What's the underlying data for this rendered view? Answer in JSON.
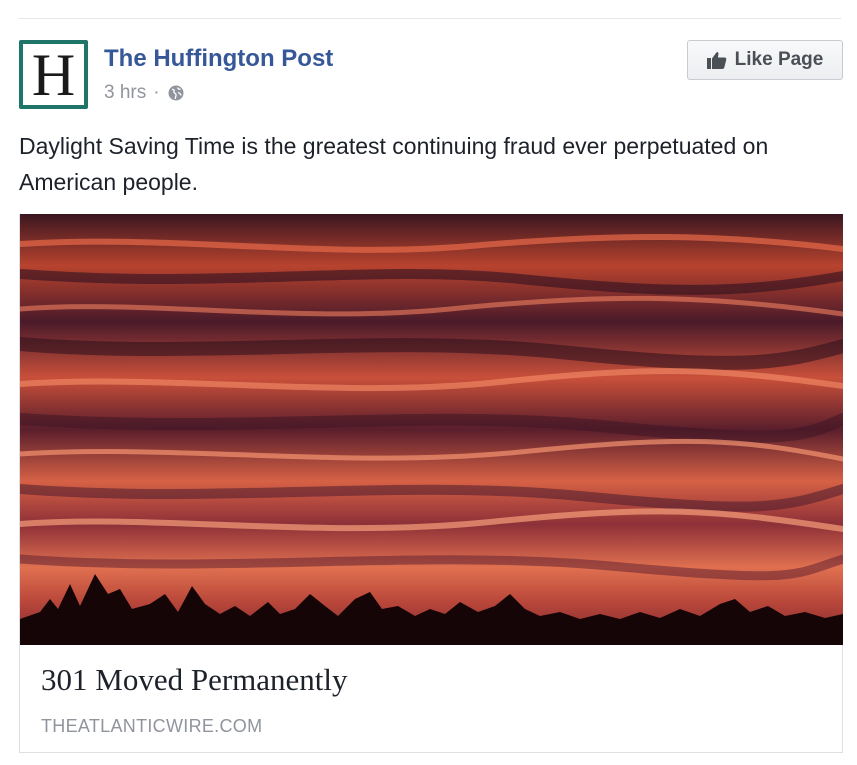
{
  "post": {
    "page_name": "The Huffington Post",
    "avatar_letter": "H",
    "timestamp": "3 hrs",
    "separator": "·",
    "privacy_icon": "globe-icon",
    "like_button_label": "Like Page",
    "like_icon": "thumbs-up-icon",
    "text": "Daylight Saving Time is the greatest continuing fraud ever perpetuated on American people."
  },
  "link_card": {
    "image_description_icon": "sunset-photo",
    "title": "301 Moved Permanently",
    "domain": "THEATLANTICWIRE.COM"
  },
  "colors": {
    "page_name": "#365899",
    "meta_text": "#90949c",
    "avatar_frame": "#1f7567",
    "body_text": "#1d2129"
  }
}
